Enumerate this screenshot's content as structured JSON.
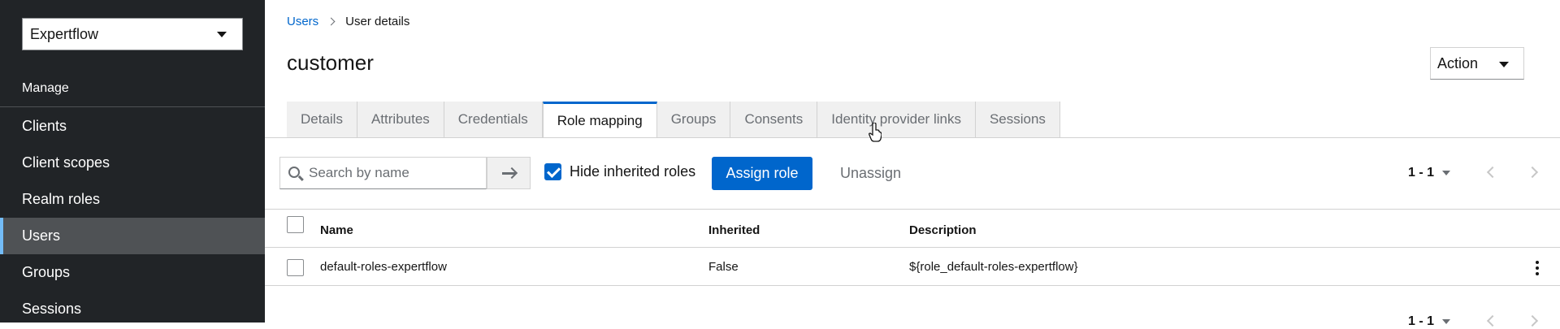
{
  "sidebar": {
    "realm": "Expertflow",
    "section": "Manage",
    "items": [
      {
        "label": "Clients"
      },
      {
        "label": "Client scopes"
      },
      {
        "label": "Realm roles"
      },
      {
        "label": "Users",
        "active": true
      },
      {
        "label": "Groups"
      },
      {
        "label": "Sessions"
      }
    ]
  },
  "breadcrumb": {
    "parent": "Users",
    "current": "User details"
  },
  "page": {
    "title": "customer",
    "action_label": "Action"
  },
  "tabs": [
    {
      "label": "Details"
    },
    {
      "label": "Attributes"
    },
    {
      "label": "Credentials"
    },
    {
      "label": "Role mapping",
      "active": true
    },
    {
      "label": "Groups"
    },
    {
      "label": "Consents"
    },
    {
      "label": "Identity provider links"
    },
    {
      "label": "Sessions"
    }
  ],
  "toolbar": {
    "search_placeholder": "Search by name",
    "hide_inherited_label": "Hide inherited roles",
    "hide_inherited_checked": true,
    "assign_label": "Assign role",
    "unassign_label": "Unassign",
    "pagination": "1 - 1"
  },
  "table": {
    "headers": {
      "name": "Name",
      "inherited": "Inherited",
      "description": "Description"
    },
    "rows": [
      {
        "name": "default-roles-expertflow",
        "inherited": "False",
        "description": "${role_default-roles-expertflow}"
      }
    ]
  },
  "bottom_pagination": "1 - 1",
  "colors": {
    "accent": "#0066cc",
    "sidebar_bg": "#212427",
    "active_nav": "#4f5255",
    "active_indicator": "#73bcf7"
  }
}
